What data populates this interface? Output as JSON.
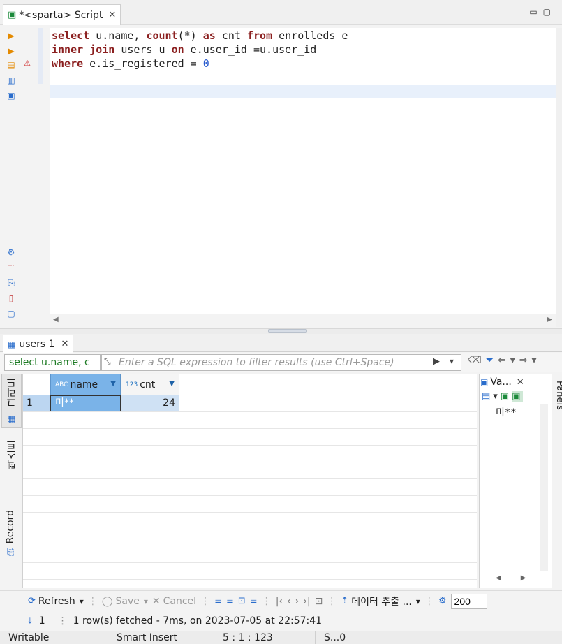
{
  "editor": {
    "tab_title": "*<sparta> Script",
    "lines": {
      "l1": {
        "k1": "select",
        "t1": " u.name, ",
        "k2": "count",
        "t2": "(*) ",
        "k3": "as",
        "t3": " cnt ",
        "k4": "from",
        "t4": " enrolleds e"
      },
      "l2": {
        "k1": "inner",
        "t1": " ",
        "k2": "join",
        "t2": " users u ",
        "k3": "on",
        "t3": " e.user_id =u.user_id"
      },
      "l3": {
        "k1": "where",
        "t1": " e.is_registered = ",
        "n1": "0"
      }
    }
  },
  "results": {
    "tab_label": "users 1",
    "filter": {
      "query_text": "select u.name, c",
      "placeholder": "Enter a SQL expression to filter results (use Ctrl+Space)"
    },
    "vertical_tabs": [
      "그리드",
      "텍스트",
      "Record"
    ],
    "columns": [
      {
        "type_badge": "ABC",
        "name": "name"
      },
      {
        "type_badge": "123",
        "name": "cnt"
      }
    ],
    "rows": [
      {
        "num": "1",
        "name": "미**",
        "cnt": "24"
      }
    ],
    "value_panel": {
      "tab_label": "Va...",
      "content": "미**"
    },
    "panels_label": "Panels"
  },
  "toolbar": {
    "refresh": "Refresh",
    "save": "Save",
    "cancel": "Cancel",
    "export": "데이터 추출 ...",
    "fetch_size": "200"
  },
  "status": {
    "row_count": "1",
    "fetch_message": "1 row(s) fetched - 7ms, on 2023-07-05 at 22:57:41",
    "writable": "Writable",
    "insert_mode": "Smart Insert",
    "position": "5 : 1 : 123",
    "extra": "S...0"
  },
  "colors": {
    "accent": "#7ab3e8",
    "keyword": "#8b1f1f",
    "number": "#2a5ccf"
  }
}
